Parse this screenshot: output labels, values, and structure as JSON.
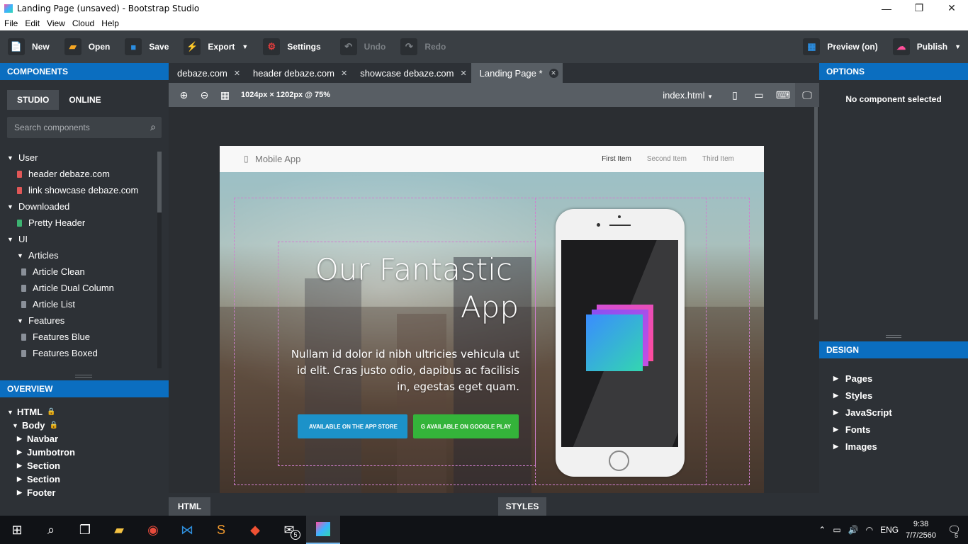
{
  "window": {
    "title": "Landing Page (unsaved) - Bootstrap Studio",
    "minimize": "—",
    "maximize": "❐",
    "close": "✕"
  },
  "menu": [
    "File",
    "Edit",
    "View",
    "Cloud",
    "Help"
  ],
  "toolbar": {
    "new": "New",
    "open": "Open",
    "save": "Save",
    "export": "Export",
    "settings": "Settings",
    "undo": "Undo",
    "redo": "Redo",
    "preview": "Preview (on)",
    "publish": "Publish"
  },
  "components": {
    "header": "COMPONENTS",
    "tab_studio": "STUDIO",
    "tab_online": "ONLINE",
    "search_placeholder": "Search components",
    "tree": [
      {
        "label": "User",
        "level": 0,
        "type": "group"
      },
      {
        "label": "header debaze.com",
        "level": 1,
        "type": "item",
        "color": "#e05757"
      },
      {
        "label": "link showcase debaze.com",
        "level": 1,
        "type": "item",
        "color": "#e05757"
      },
      {
        "label": "Downloaded",
        "level": 0,
        "type": "group"
      },
      {
        "label": "Pretty Header",
        "level": 1,
        "type": "item",
        "color": "#3cb371"
      },
      {
        "label": "UI",
        "level": 0,
        "type": "group"
      },
      {
        "label": "Articles",
        "level": 1,
        "type": "group"
      },
      {
        "label": "Article Clean",
        "level": 2,
        "type": "item",
        "color": "#8a9099"
      },
      {
        "label": "Article Dual Column",
        "level": 2,
        "type": "item",
        "color": "#8a9099"
      },
      {
        "label": "Article List",
        "level": 2,
        "type": "item",
        "color": "#8a9099"
      },
      {
        "label": "Features",
        "level": 1,
        "type": "group"
      },
      {
        "label": "Features Blue",
        "level": 2,
        "type": "item",
        "color": "#8a9099"
      },
      {
        "label": "Features Boxed",
        "level": 2,
        "type": "item",
        "color": "#8a9099"
      }
    ]
  },
  "overview": {
    "header": "OVERVIEW",
    "nodes": [
      {
        "label": "HTML",
        "level": 0,
        "open": true,
        "locked": true
      },
      {
        "label": "Body",
        "level": 1,
        "open": true,
        "locked": true
      },
      {
        "label": "Navbar",
        "level": 2,
        "open": false,
        "locked": false
      },
      {
        "label": "Jumbotron",
        "level": 2,
        "open": false,
        "locked": false
      },
      {
        "label": "Section",
        "level": 2,
        "open": false,
        "locked": false
      },
      {
        "label": "Section",
        "level": 2,
        "open": false,
        "locked": false
      },
      {
        "label": "Footer",
        "level": 2,
        "open": false,
        "locked": false
      }
    ]
  },
  "tabs": [
    {
      "label": "debaze.com",
      "active": false
    },
    {
      "label": "header debaze.com",
      "active": false
    },
    {
      "label": "showcase debaze.com",
      "active": false
    },
    {
      "label": "Landing Page *",
      "active": true
    }
  ],
  "canvas": {
    "dimensions": "1024px × 1202px @ 75%",
    "file": "index.html"
  },
  "preview_page": {
    "brand": "Mobile App",
    "nav_items": [
      "First Item",
      "Second Item",
      "Third Item"
    ],
    "heading_line1": "Our Fantastic",
    "heading_line2": "App",
    "lead": "Nullam id dolor id nibh ultricies vehicula ut id elit. Cras justo odio, dapibus ac facilisis in, egestas eget quam.",
    "btn_appstore": "AVAILABLE ON THE APP STORE",
    "btn_google": "AVAILABLE ON GOOGLE PLAY"
  },
  "options": {
    "header": "OPTIONS",
    "empty": "No component selected"
  },
  "design": {
    "header": "DESIGN",
    "items": [
      "Pages",
      "Styles",
      "JavaScript",
      "Fonts",
      "Images"
    ]
  },
  "bottom": {
    "html": "HTML",
    "styles": "STYLES"
  },
  "taskbar": {
    "mail_badge": "5",
    "lang": "ENG",
    "time": "9:38",
    "date": "7/7/2560",
    "notif_badge": "5"
  },
  "colors": {
    "accent": "#0b6ec0",
    "appstore": "#1c92c9",
    "google": "#34b43a"
  }
}
